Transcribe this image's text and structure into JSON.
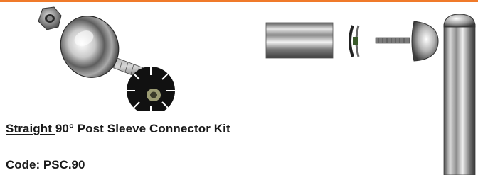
{
  "colors": {
    "accent_border": "#f07a2a",
    "text": "#1a1a1a"
  },
  "illustrations": {
    "left": "exploded-view-nut-dome-bolt-saw-disc",
    "middle": "exploded-view-tube-insert-bolt-dome-cap",
    "right": "vertical-post-with-dome-cap"
  },
  "title": {
    "underlined_part": "Straight ",
    "rest": "90° Post Sleeve Connector Kit"
  },
  "code": {
    "text": "Code: PSC.90"
  }
}
